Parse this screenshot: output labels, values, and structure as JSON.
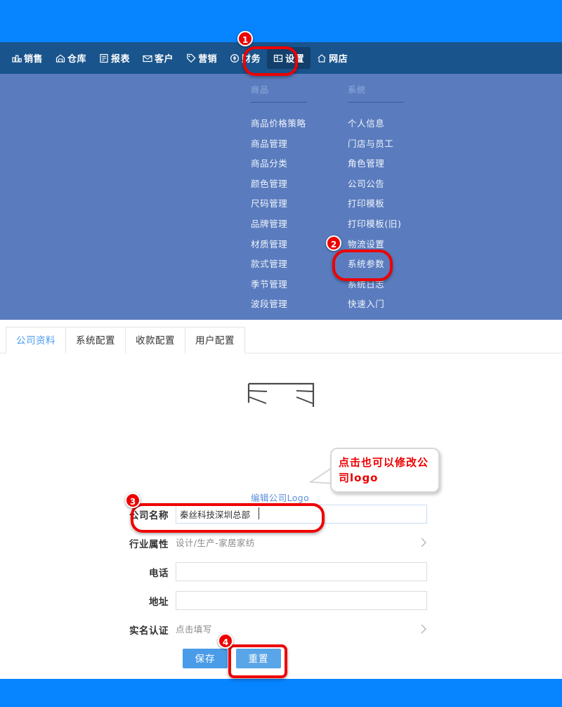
{
  "theme": {
    "band_blue": "#0784ff",
    "navbar_blue": "#19548c",
    "dropdown_blue": "#5a7cbe",
    "accent_blue": "#4a9ce8",
    "annotation_red": "#ee0000"
  },
  "navbar": {
    "items": [
      {
        "label": "销售",
        "icon": "sales-icon",
        "active": false
      },
      {
        "label": "仓库",
        "icon": "warehouse-icon",
        "active": false
      },
      {
        "label": "报表",
        "icon": "report-icon",
        "active": false
      },
      {
        "label": "客户",
        "icon": "customer-icon",
        "active": false
      },
      {
        "label": "营销",
        "icon": "marketing-tag-icon",
        "active": false
      },
      {
        "label": "财务",
        "icon": "finance-icon",
        "active": false
      },
      {
        "label": "设置",
        "icon": "settings-icon",
        "active": true
      },
      {
        "label": "网店",
        "icon": "online-shop-home-icon",
        "active": false
      }
    ]
  },
  "dropdown": {
    "columns": [
      {
        "header": "商品",
        "items": [
          "商品价格策略",
          "商品管理",
          "商品分类",
          "颜色管理",
          "尺码管理",
          "品牌管理",
          "材质管理",
          "款式管理",
          "季节管理",
          "波段管理"
        ]
      },
      {
        "header": "系统",
        "items": [
          "个人信息",
          "门店与员工",
          "角色管理",
          "公司公告",
          "打印模板",
          "打印模板(旧)",
          "物流设置",
          "系统参数",
          "系统日志",
          "快速入门"
        ]
      }
    ]
  },
  "tabs": [
    {
      "label": "公司资料",
      "active": true
    },
    {
      "label": "系统配置",
      "active": false
    },
    {
      "label": "收款配置",
      "active": false
    },
    {
      "label": "用户配置",
      "active": false
    }
  ],
  "form": {
    "logo_edit_link": "编辑公司Logo",
    "fields": [
      {
        "label": "公司名称",
        "type": "input",
        "value": "秦丝科技深圳总部",
        "placeholder": "",
        "chevron": false
      },
      {
        "label": "行业属性",
        "type": "static",
        "value": "设计/生产-家居家纺",
        "chevron": true
      },
      {
        "label": "电话",
        "type": "input",
        "value": "",
        "placeholder": "",
        "chevron": false
      },
      {
        "label": "地址",
        "type": "input",
        "value": "",
        "placeholder": "",
        "chevron": false
      },
      {
        "label": "实名认证",
        "type": "static",
        "value": "点击填写",
        "chevron": true
      }
    ],
    "buttons": {
      "save": "保存",
      "reset": "重置"
    }
  },
  "annotations": {
    "markers": [
      {
        "number": "1",
        "target": "设置"
      },
      {
        "number": "2",
        "target": "系统参数"
      },
      {
        "number": "3",
        "target": "公司名称"
      },
      {
        "number": "4",
        "target": "保存"
      }
    ],
    "callout": "点击也可以修改公司logo"
  }
}
